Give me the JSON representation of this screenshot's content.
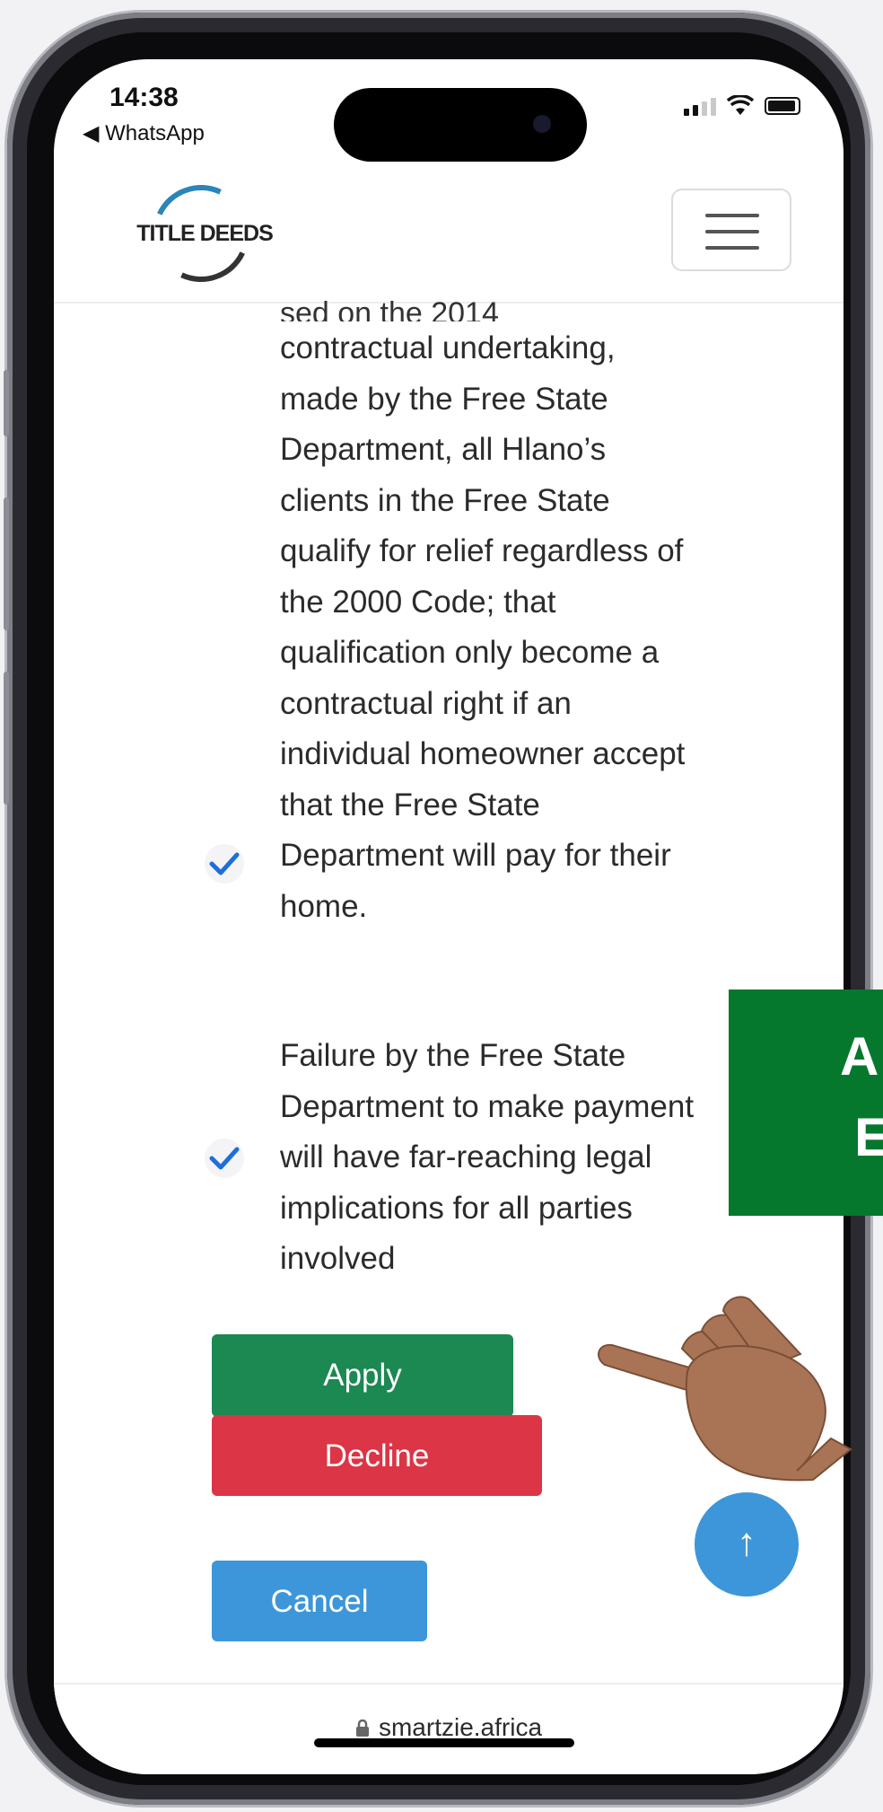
{
  "status_bar": {
    "time": "14:38",
    "back_app": "◀ WhatsApp"
  },
  "header": {
    "logo_text": "TITLE DEEDS"
  },
  "content": {
    "cut_line": "sed on the 2014",
    "items": [
      {
        "text": "contractual undertaking, made by the Free State Department, all Hlano’s clients in the Free State qualify for relief regardless of the 2000 Code; that qualification only become a contractual right if an individual homeowner accept that the Free State Department will pay for their home."
      },
      {
        "text": "Failure by the Free State Department to make payment will have far-reaching legal implications for all parties involved"
      }
    ]
  },
  "buttons": {
    "apply": "Apply",
    "decline": "Decline",
    "cancel": "Cancel",
    "scroll_top": "↑"
  },
  "url_bar": {
    "url": "smartzie.africa"
  },
  "overlay": {
    "line1": "A",
    "line2": "E"
  },
  "colors": {
    "apply": "#1c8852",
    "decline": "#dc3545",
    "cancel": "#3d96d9",
    "overlay_green": "#06782d",
    "check_blue": "#1e6fd9"
  }
}
